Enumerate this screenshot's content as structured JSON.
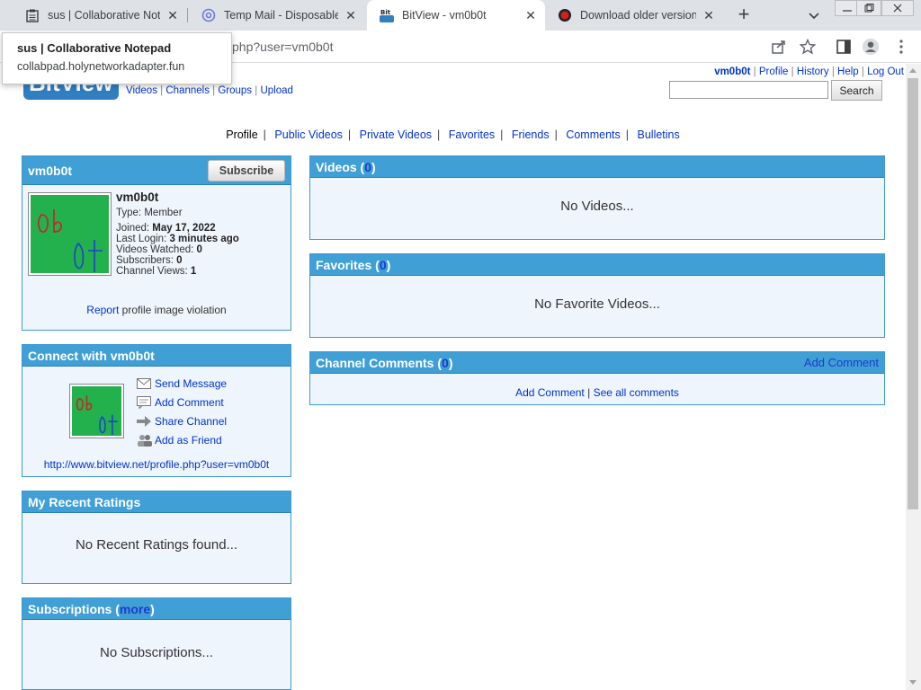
{
  "browser": {
    "tabs": [
      {
        "title": "sus | Collaborative Notepad",
        "icon": "notepad-icon"
      },
      {
        "title": "Temp Mail - Disposable Temporary Email",
        "icon": "at-sign-icon"
      },
      {
        "title": "BitView - vm0b0t",
        "icon": "bitview-icon",
        "active": true
      },
      {
        "title": "Download older versions",
        "icon": "record-icon"
      }
    ],
    "url_fragment": "php?user=vm0b0t",
    "tooltip": {
      "title": "sus | Collaborative Notepad",
      "url": "collabpad.holynetworkadapter.fun"
    }
  },
  "site": {
    "logo_text": "BitView",
    "nav": [
      "Videos",
      "Channels",
      "Groups",
      "Upload"
    ],
    "user_links": {
      "username": "vm0b0t",
      "items": [
        "Profile",
        "History",
        "Help",
        "Log Out"
      ]
    },
    "search_button": "Search"
  },
  "subnav": {
    "current": "Profile",
    "links": [
      "Public Videos",
      "Private Videos",
      "Favorites",
      "Friends",
      "Comments",
      "Bulletins"
    ]
  },
  "profile_box": {
    "title": "vm0b0t",
    "subscribe": "Subscribe",
    "name": "vm0b0t",
    "type_label": "Type:",
    "type_value": "Member",
    "joined_label": "Joined:",
    "joined_value": "May 17, 2022",
    "login_label": "Last Login:",
    "login_value": "3 minutes ago",
    "watched_label": "Videos Watched:",
    "watched_value": "0",
    "subs_label": "Subscribers:",
    "subs_value": "0",
    "views_label": "Channel Views:",
    "views_value": "1",
    "report_link": "Report",
    "report_text": " profile image violation"
  },
  "connect_box": {
    "title": "Connect with vm0b0t",
    "actions": [
      "Send Message",
      "Add Comment",
      "Share Channel",
      "Add as Friend"
    ],
    "profile_url": "http://www.bitview.net/profile.php?user=vm0b0t"
  },
  "ratings_box": {
    "title": "My Recent Ratings",
    "empty": "No Recent Ratings found..."
  },
  "subs_box": {
    "title_pre": "Subscriptions (",
    "more": "more",
    "title_post": ")",
    "empty": "No Subscriptions..."
  },
  "videos_box": {
    "title_pre": "Videos (",
    "count": "0",
    "title_post": ")",
    "empty": "No Videos..."
  },
  "favorites_box": {
    "title_pre": "Favorites (",
    "count": "0",
    "title_post": ")",
    "empty": "No Favorite Videos..."
  },
  "comments_box": {
    "title_pre": "Channel Comments (",
    "count": "0",
    "title_post": ")",
    "add_comment": "Add Comment",
    "link_add": "Add Comment",
    "link_sep": " | ",
    "link_all": "See all comments"
  },
  "colors": {
    "box_header": "#409fd5",
    "box_bg": "#eef5fc",
    "link": "#0033cc",
    "avatar_green": "#22b14c"
  }
}
